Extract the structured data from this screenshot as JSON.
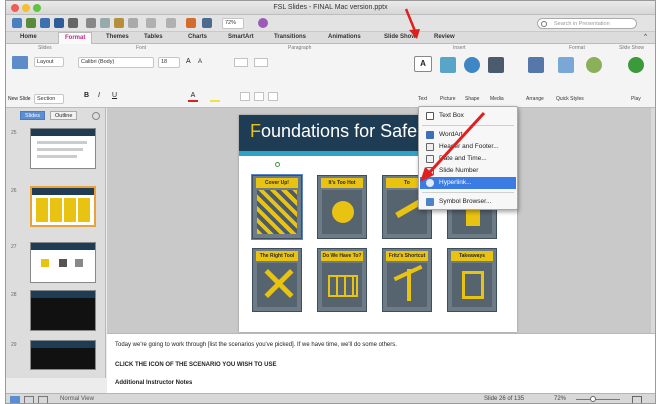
{
  "window": {
    "title": "FSL Slides - FINAL Mac version.pptx",
    "zoom": "72%"
  },
  "search": {
    "placeholder": "Search in Presentation"
  },
  "ribbon_tabs": [
    "Home",
    "Format",
    "Themes",
    "Tables",
    "Charts",
    "SmartArt",
    "Transitions",
    "Animations",
    "Slide Show",
    "Review"
  ],
  "ribbon_groups": [
    "Slides",
    "Font",
    "Paragraph",
    "Insert",
    "Format",
    "Slide Show"
  ],
  "ribbon": {
    "new_slide": "New Slide",
    "layout": "Layout",
    "section": "Section",
    "font_name": "Calibri (Body)",
    "font_size": "18",
    "insert_labels": [
      "Text",
      "Picture",
      "Shape",
      "Media"
    ],
    "format_labels": [
      "Arrange",
      "Quick Styles"
    ],
    "play": "Play"
  },
  "left_panel": {
    "tabs": [
      "Slides",
      "Outline"
    ],
    "slide_numbers": [
      "25",
      "26",
      "27",
      "28",
      "29"
    ]
  },
  "slide": {
    "title_prefix": "F",
    "title_rest": "oundations for Safe",
    "cards": [
      "Cover Up!",
      "It's Too Hot",
      "To",
      "",
      "The Right Tool",
      "Do We Have To?",
      "Fritz's Shortcut",
      "Takeaways"
    ]
  },
  "insert_menu": {
    "items": [
      {
        "label": "Text Box",
        "icon": "textbox-icon"
      },
      {
        "label": "WordArt",
        "icon": "wordart-icon"
      },
      {
        "label": "Header and Footer...",
        "icon": "header-footer-icon"
      },
      {
        "label": "Date and Time...",
        "icon": "date-time-icon"
      },
      {
        "label": "Slide Number",
        "icon": "slide-number-icon"
      },
      {
        "label": "Hyperlink...",
        "icon": "hyperlink-icon"
      },
      {
        "label": "Symbol Browser...",
        "icon": "symbol-icon"
      }
    ],
    "highlighted": "Hyperlink..."
  },
  "notes": {
    "line1": "Today we're going to work through [list the scenarios you've picked]. If we have time, we'll do some others.",
    "line2": "CLICK THE ICON OF THE SCENARIO YOU WISH TO USE",
    "line3": "Additional Instructor Notes"
  },
  "status": {
    "view": "Normal View",
    "slide_of": "Slide 26 of 135",
    "zoom": "72%"
  },
  "colors": {
    "accent": "#c02a8e",
    "highlight": "#3b7ce4",
    "slide_band": "#1e3d55",
    "card_label": "#e9c312",
    "arrow": "#e0201f"
  }
}
